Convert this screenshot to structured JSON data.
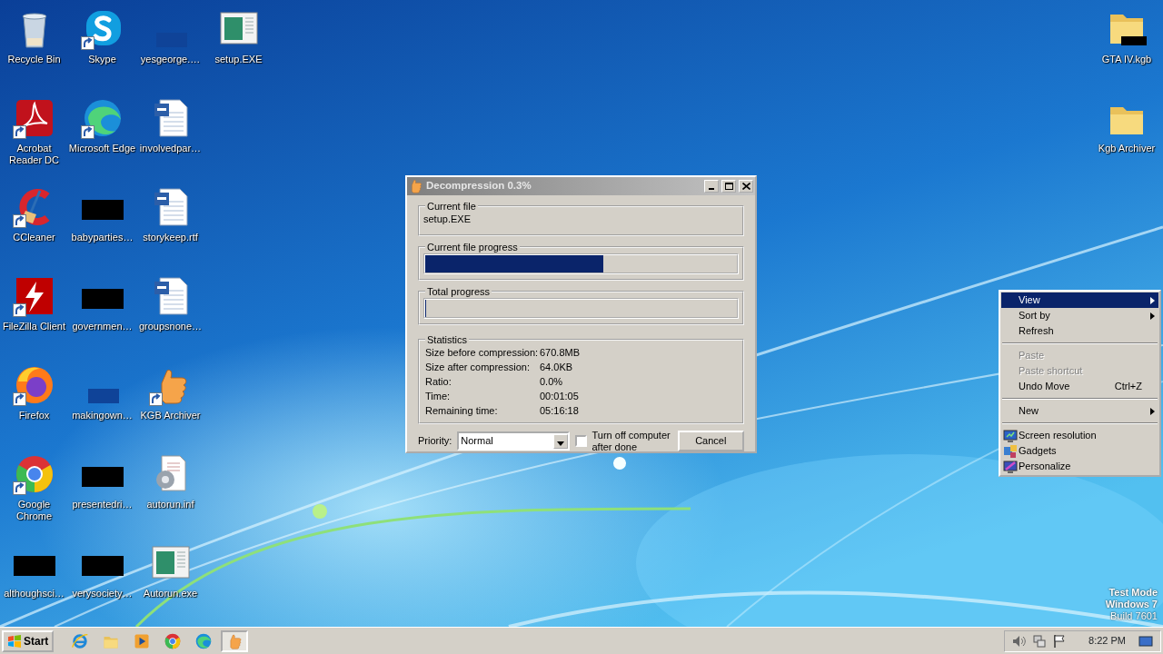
{
  "desktop_icons": [
    {
      "label": "Recycle Bin",
      "kind": "recycle",
      "shortcut": false
    },
    {
      "label": "Acrobat Reader DC",
      "kind": "acrobat",
      "shortcut": true
    },
    {
      "label": "CCleaner",
      "kind": "ccleaner",
      "shortcut": true
    },
    {
      "label": "FileZilla Client",
      "kind": "filezilla",
      "shortcut": true
    },
    {
      "label": "Firefox",
      "kind": "firefox",
      "shortcut": true
    },
    {
      "label": "Google Chrome",
      "kind": "chrome",
      "shortcut": true
    },
    {
      "label": "althoughsci…",
      "kind": "redacted",
      "shortcut": false
    },
    {
      "label": "Skype",
      "kind": "skype",
      "shortcut": true
    },
    {
      "label": "Microsoft Edge",
      "kind": "edge",
      "shortcut": true
    },
    {
      "label": "babyparties…",
      "kind": "redacted",
      "shortcut": false
    },
    {
      "label": "governmen…",
      "kind": "redacted",
      "shortcut": false
    },
    {
      "label": "makingown…",
      "kind": "blank",
      "shortcut": false
    },
    {
      "label": "presentedri…",
      "kind": "redacted",
      "shortcut": false
    },
    {
      "label": "verysociety…",
      "kind": "redacted",
      "shortcut": false
    },
    {
      "label": "yesgeorge.…",
      "kind": "blank",
      "shortcut": false
    },
    {
      "label": "involvedpar…",
      "kind": "word",
      "shortcut": false
    },
    {
      "label": "storykeep.rtf",
      "kind": "word",
      "shortcut": false
    },
    {
      "label": "groupsnone…",
      "kind": "word",
      "shortcut": false
    },
    {
      "label": "KGB Archiver",
      "kind": "thumb",
      "shortcut": true
    },
    {
      "label": "autorun.inf",
      "kind": "inf",
      "shortcut": false
    },
    {
      "label": "Autorun.exe",
      "kind": "exe",
      "shortcut": false
    },
    {
      "label": "setup.EXE",
      "kind": "exe",
      "shortcut": false
    }
  ],
  "right_icons": [
    {
      "label": "GTA IV.kgb",
      "kind": "kgb_folder",
      "shortcut": false
    },
    {
      "label": "Kgb Archiver",
      "kind": "folder",
      "shortcut": false
    }
  ],
  "dialog": {
    "title": "Decompression 0.3%",
    "current_file": {
      "legend": "Current file",
      "value": "setup.EXE"
    },
    "current_progress": {
      "legend": "Current file progress",
      "level": 0.57
    },
    "total_progress": {
      "legend": "Total progress",
      "level": 0.003
    },
    "statistics": {
      "legend": "Statistics",
      "rows": [
        {
          "label": "Size before compression:",
          "value": "670.8MB"
        },
        {
          "label": "Size after compression:",
          "value": "64.0KB"
        },
        {
          "label": "Ratio:",
          "value": "0.0%"
        },
        {
          "label": "Time:",
          "value": "00:01:05"
        },
        {
          "label": "Remaining time:",
          "value": "05:16:18"
        }
      ]
    },
    "priority": {
      "label": "Priority:",
      "value": "Normal"
    },
    "shutdown": {
      "label": "Turn off computer after done",
      "checked": false
    },
    "cancel": "Cancel"
  },
  "context_menu": [
    {
      "kind": "item",
      "label": "View",
      "submenu": true,
      "disabled": false,
      "selected": true
    },
    {
      "kind": "item",
      "label": "Sort by",
      "submenu": true,
      "disabled": false,
      "selected": false
    },
    {
      "kind": "item",
      "label": "Refresh",
      "submenu": false,
      "disabled": false,
      "selected": false
    },
    {
      "kind": "separator"
    },
    {
      "kind": "item",
      "label": "Paste",
      "submenu": false,
      "disabled": true,
      "selected": false
    },
    {
      "kind": "item",
      "label": "Paste shortcut",
      "submenu": false,
      "disabled": true,
      "selected": false
    },
    {
      "kind": "item",
      "label": "Undo Move",
      "shortcut": "Ctrl+Z",
      "submenu": false,
      "disabled": false,
      "selected": false
    },
    {
      "kind": "separator"
    },
    {
      "kind": "item",
      "label": "New",
      "submenu": true,
      "disabled": false,
      "selected": false
    },
    {
      "kind": "separator"
    },
    {
      "kind": "display",
      "label": "Screen resolution",
      "submenu": false,
      "disabled": false,
      "selected": false
    },
    {
      "kind": "gadgets",
      "label": "Gadgets",
      "submenu": false,
      "disabled": false,
      "selected": false
    },
    {
      "kind": "personalize",
      "label": "Personalize",
      "submenu": false,
      "disabled": false,
      "selected": false
    }
  ],
  "taskbar": {
    "start": "Start",
    "apps": [
      {
        "kind": "ie",
        "active": false
      },
      {
        "kind": "folder",
        "active": false
      },
      {
        "kind": "media",
        "active": false
      },
      {
        "kind": "chrome",
        "active": false
      },
      {
        "kind": "edge",
        "active": false
      },
      {
        "kind": "thumb",
        "active": true
      }
    ],
    "clock": "8:22 PM"
  },
  "os_notice": [
    {
      "text": "Test Mode",
      "bold": true
    },
    {
      "text": "Windows 7",
      "bold": true
    },
    {
      "text": "Build 7601",
      "bold": false
    }
  ]
}
